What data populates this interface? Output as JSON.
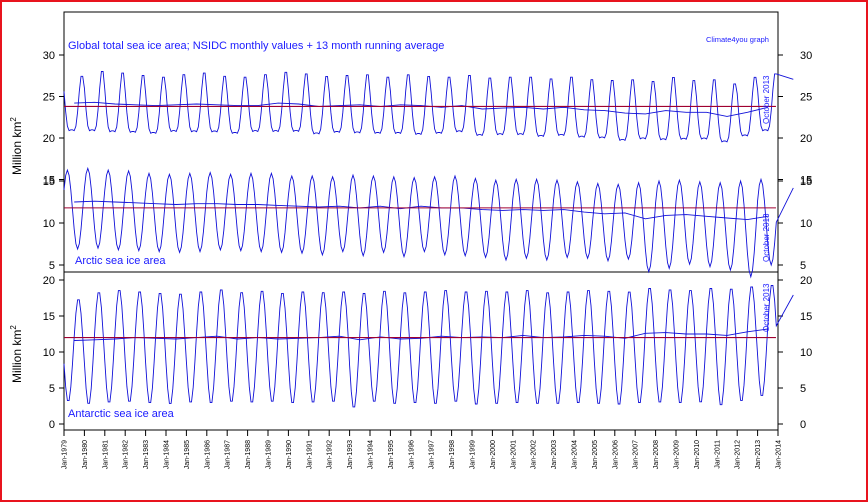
{
  "chart_data": [
    {
      "type": "line",
      "title": "Global total sea ice area; NSIDC monthly values + 13 month running average",
      "ylabel": "Million km",
      "ylabel_superscript": "2",
      "ylim": [
        15,
        30
      ],
      "yticks": [
        15,
        20,
        25,
        30
      ],
      "xlim": [
        1979,
        2014
      ],
      "credit": "Climate4you graph",
      "side_note": "October 2013",
      "series": [
        {
          "values_description": "monthly values",
          "annual_min": [
            18.8,
            18.6,
            18.5,
            18.5,
            18.4,
            18.6,
            18.5,
            18.6,
            18.4,
            18.6,
            18.5,
            18.6,
            18.3,
            18.5,
            18.4,
            18.4,
            18.3,
            18.2,
            18.4,
            18.6,
            18.1,
            18.2,
            18.2,
            18.0,
            18.1,
            17.9,
            17.8,
            17.4,
            17.7,
            17.4,
            17.6,
            17.6,
            17.3,
            18.0,
            18.7
          ],
          "annual_max": [
            27.7,
            28.3,
            28.1,
            27.8,
            27.6,
            27.9,
            28.1,
            27.7,
            27.6,
            27.9,
            28.2,
            28.0,
            27.7,
            27.8,
            27.9,
            27.6,
            27.9,
            27.7,
            27.6,
            27.8,
            27.5,
            27.6,
            27.6,
            27.4,
            27.6,
            27.3,
            27.2,
            27.3,
            27.1,
            27.6,
            27.2,
            27.3,
            26.8,
            27.6,
            28.0
          ]
        },
        {
          "values_description": "13 month running average",
          "annual": [
            24.2,
            24.3,
            24.1,
            24.0,
            23.9,
            24.0,
            24.1,
            24.0,
            23.9,
            23.9,
            24.2,
            24.1,
            23.8,
            23.9,
            24.0,
            23.8,
            24.0,
            23.9,
            23.7,
            23.9,
            23.5,
            23.6,
            23.7,
            23.5,
            23.7,
            23.4,
            23.3,
            23.0,
            22.9,
            23.3,
            23.1,
            23.1,
            22.6,
            23.1,
            23.7
          ]
        }
      ],
      "reference_line": 23.8
    },
    {
      "type": "line",
      "label": "Arctic sea ice area",
      "ylim": [
        5,
        17
      ],
      "yticks": [
        5,
        10,
        15
      ],
      "xlim": [
        1979,
        2014
      ],
      "side_note": "October 2013",
      "series": [
        {
          "values_description": "monthly values",
          "annual_min": [
            6.9,
            7.0,
            6.8,
            6.7,
            6.6,
            6.5,
            6.6,
            6.8,
            6.7,
            6.6,
            6.5,
            6.4,
            6.2,
            6.6,
            6.1,
            6.5,
            6.0,
            6.6,
            6.2,
            6.1,
            5.9,
            5.6,
            5.8,
            5.6,
            5.9,
            5.8,
            5.5,
            5.7,
            4.2,
            4.6,
            5.1,
            4.8,
            4.4,
            3.6,
            5.0
          ],
          "annual_max": [
            16.3,
            16.5,
            16.3,
            16.2,
            15.9,
            15.8,
            15.9,
            16.0,
            15.8,
            15.9,
            15.9,
            15.6,
            15.6,
            15.5,
            15.7,
            15.6,
            15.5,
            15.4,
            15.5,
            15.6,
            15.3,
            15.1,
            15.2,
            15.2,
            15.1,
            14.9,
            14.7,
            14.6,
            14.8,
            15.0,
            15.1,
            14.9,
            14.8,
            15.0,
            15.2
          ]
        },
        {
          "values_description": "13 month running average",
          "annual": [
            12.5,
            12.6,
            12.5,
            12.4,
            12.3,
            12.2,
            12.3,
            12.3,
            12.2,
            12.2,
            12.1,
            12.0,
            11.9,
            12.0,
            11.8,
            12.0,
            11.7,
            12.0,
            11.8,
            11.8,
            11.6,
            11.5,
            11.6,
            11.5,
            11.6,
            11.3,
            11.1,
            11.2,
            10.5,
            10.9,
            11.0,
            10.8,
            10.6,
            10.4,
            10.8
          ]
        }
      ],
      "reference_line": 11.8
    },
    {
      "type": "line",
      "label": "Antarctic sea ice area",
      "ylabel": "Million km",
      "ylabel_superscript": "2",
      "ylim": [
        0,
        20
      ],
      "yticks": [
        0,
        5,
        10,
        15,
        20
      ],
      "xlim": [
        1979,
        2014
      ],
      "side_note": "October 2013",
      "series": [
        {
          "values_description": "monthly values",
          "annual_min": [
            3.0,
            2.6,
            2.8,
            2.9,
            2.7,
            2.6,
            2.8,
            2.7,
            2.9,
            2.8,
            2.9,
            2.7,
            2.8,
            2.9,
            2.1,
            2.9,
            2.6,
            2.7,
            2.6,
            2.9,
            2.5,
            2.6,
            2.7,
            2.6,
            2.6,
            2.7,
            2.6,
            2.5,
            2.7,
            2.8,
            2.7,
            2.8,
            2.4,
            3.0,
            3.7
          ],
          "annual_max": [
            17.5,
            18.5,
            18.8,
            18.6,
            18.4,
            18.3,
            18.6,
            18.9,
            18.5,
            18.7,
            18.4,
            18.6,
            18.5,
            18.6,
            18.4,
            18.7,
            18.5,
            18.6,
            18.8,
            18.6,
            18.7,
            18.6,
            18.8,
            18.5,
            18.6,
            18.8,
            18.7,
            18.6,
            19.1,
            18.9,
            18.8,
            19.1,
            19.0,
            19.3,
            19.5
          ]
        },
        {
          "values_description": "13 month running average",
          "annual": [
            11.6,
            11.7,
            11.8,
            12.0,
            11.9,
            11.8,
            12.0,
            12.2,
            11.8,
            12.0,
            11.8,
            11.9,
            12.0,
            12.2,
            11.7,
            12.1,
            11.8,
            11.9,
            12.2,
            12.0,
            12.1,
            12.0,
            12.3,
            12.0,
            12.1,
            12.3,
            12.2,
            11.9,
            12.6,
            12.7,
            12.5,
            12.5,
            12.3,
            12.8,
            13.2
          ]
        }
      ],
      "reference_line": 12.0
    }
  ],
  "x_tick_labels": [
    "Jan-1979",
    "Jan-1980",
    "Jan-1981",
    "Jan-1982",
    "Jan-1983",
    "Jan-1984",
    "Jan-1985",
    "Jan-1986",
    "Jan-1987",
    "Jan-1988",
    "Jan-1989",
    "Jan-1990",
    "Jan-1991",
    "Jan-1992",
    "Jan-1993",
    "Jan-1994",
    "Jan-1995",
    "Jan-1996",
    "Jan-1997",
    "Jan-1998",
    "Jan-1999",
    "Jan-2000",
    "Jan-2001",
    "Jan-2002",
    "Jan-2003",
    "Jan-2004",
    "Jan-2005",
    "Jan-2006",
    "Jan-2007",
    "Jan-2008",
    "Jan-2009",
    "Jan-2010",
    "Jan-2011",
    "Jan-2012",
    "Jan-2013",
    "Jan-2014"
  ],
  "colors": {
    "series": "#1010d8",
    "average": "#1010d8",
    "reference": "#a00030",
    "frame": "#e8141e",
    "label": "#1a1aff"
  }
}
